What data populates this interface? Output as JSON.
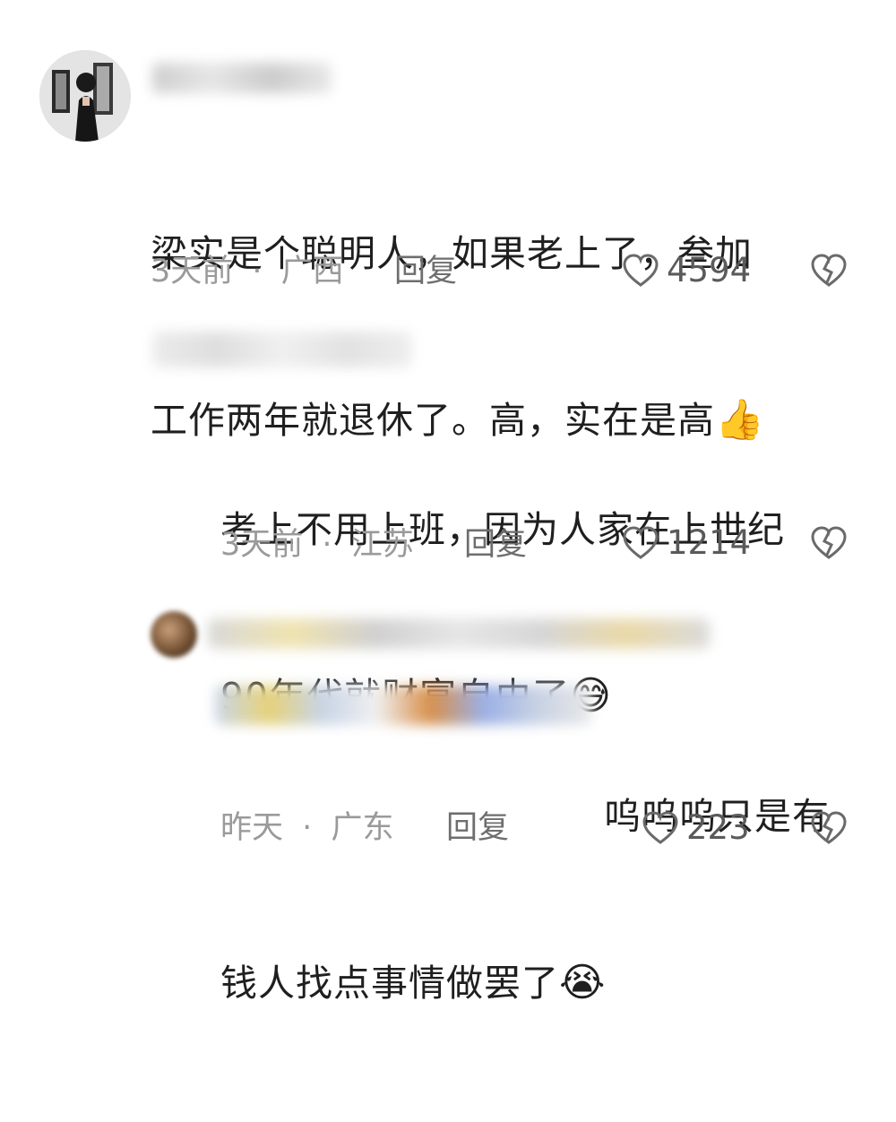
{
  "comments": [
    {
      "text_line1": "梁实是个聪明人，如果老上了，叁加",
      "text_line2": "工作两年就退休了。高，实在是高",
      "emoji": "👍",
      "time": "3天前",
      "location": "广西",
      "reply_label": "回复",
      "likes": "4594"
    },
    {
      "text_line1": "考上不用上班，因为人家在上世纪",
      "text_line2": "90年代就财富自由了",
      "emoji": "😅",
      "time": "3天前",
      "location": "江苏",
      "reply_label": "回复",
      "likes": "1214"
    },
    {
      "text_line1_visible": "呜呜呜只是有",
      "text_line2": "钱人找点事情做罢了",
      "emoji": "😭",
      "time": "昨天",
      "location": "广东",
      "reply_label": "回复",
      "likes": "223"
    }
  ],
  "meta_separator": "·",
  "icons": {
    "like": "heart-outline-icon",
    "dislike": "broken-heart-icon"
  }
}
